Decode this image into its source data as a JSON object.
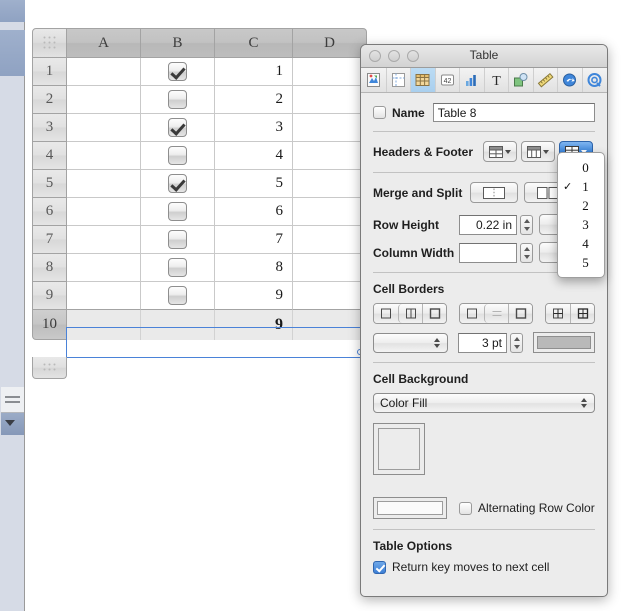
{
  "spreadsheet": {
    "columns": [
      "A",
      "B",
      "C",
      "D"
    ],
    "rows": [
      {
        "num": "1",
        "a": "",
        "checked": true,
        "c": "1",
        "d": ""
      },
      {
        "num": "2",
        "a": "",
        "checked": false,
        "c": "2",
        "d": ""
      },
      {
        "num": "3",
        "a": "",
        "checked": true,
        "c": "3",
        "d": ""
      },
      {
        "num": "4",
        "a": "",
        "checked": false,
        "c": "4",
        "d": ""
      },
      {
        "num": "5",
        "a": "",
        "checked": true,
        "c": "5",
        "d": ""
      },
      {
        "num": "6",
        "a": "",
        "checked": false,
        "c": "6",
        "d": ""
      },
      {
        "num": "7",
        "a": "",
        "checked": false,
        "c": "7",
        "d": ""
      },
      {
        "num": "8",
        "a": "",
        "checked": false,
        "c": "8",
        "d": ""
      },
      {
        "num": "9",
        "a": "",
        "checked": false,
        "c": "9",
        "d": ""
      }
    ],
    "footer_row": {
      "num": "10",
      "a": "",
      "b": "",
      "c": "9",
      "d": ""
    }
  },
  "inspector": {
    "title": "Table",
    "toolbar_icons": [
      "document-icon",
      "layout-icon",
      "table-icon",
      "cells-42-icon",
      "chart-icon",
      "text-icon",
      "graphic-icon",
      "metrics-icon",
      "link-icon",
      "quicktime-icon"
    ],
    "name": {
      "label": "Name",
      "checked": false,
      "value": "Table 8"
    },
    "headers_footer": {
      "label": "Headers & Footer",
      "header_rows_button": "header-rows",
      "header_columns_button": "header-columns",
      "footer_rows_button": "footer-rows",
      "footer_active": true
    },
    "footer_dropdown": {
      "options": [
        "0",
        "1",
        "2",
        "3",
        "4",
        "5"
      ],
      "selected": "1",
      "checkmark": "✓"
    },
    "merge_split": {
      "label": "Merge and Split"
    },
    "row_height": {
      "label": "Row Height",
      "value": "0.22 in"
    },
    "column_width": {
      "label": "Column Width",
      "value": ""
    },
    "cell_borders": {
      "label": "Cell Borders",
      "stroke_style": "",
      "width_value": "3 pt"
    },
    "cell_background": {
      "label": "Cell Background",
      "fill_type": "Color Fill",
      "alternating_label": "Alternating Row Color",
      "alternating_checked": false
    },
    "table_options": {
      "label": "Table Options",
      "return_key_label": "Return key moves to next cell",
      "return_key_checked": true
    }
  },
  "colors": {
    "accent": "#3f86da",
    "selection_outline": "#4a82d8",
    "panel_bg": "#ececec",
    "header_bg": "#c2c2c2",
    "footer_row_bg": "#eaeaea"
  }
}
